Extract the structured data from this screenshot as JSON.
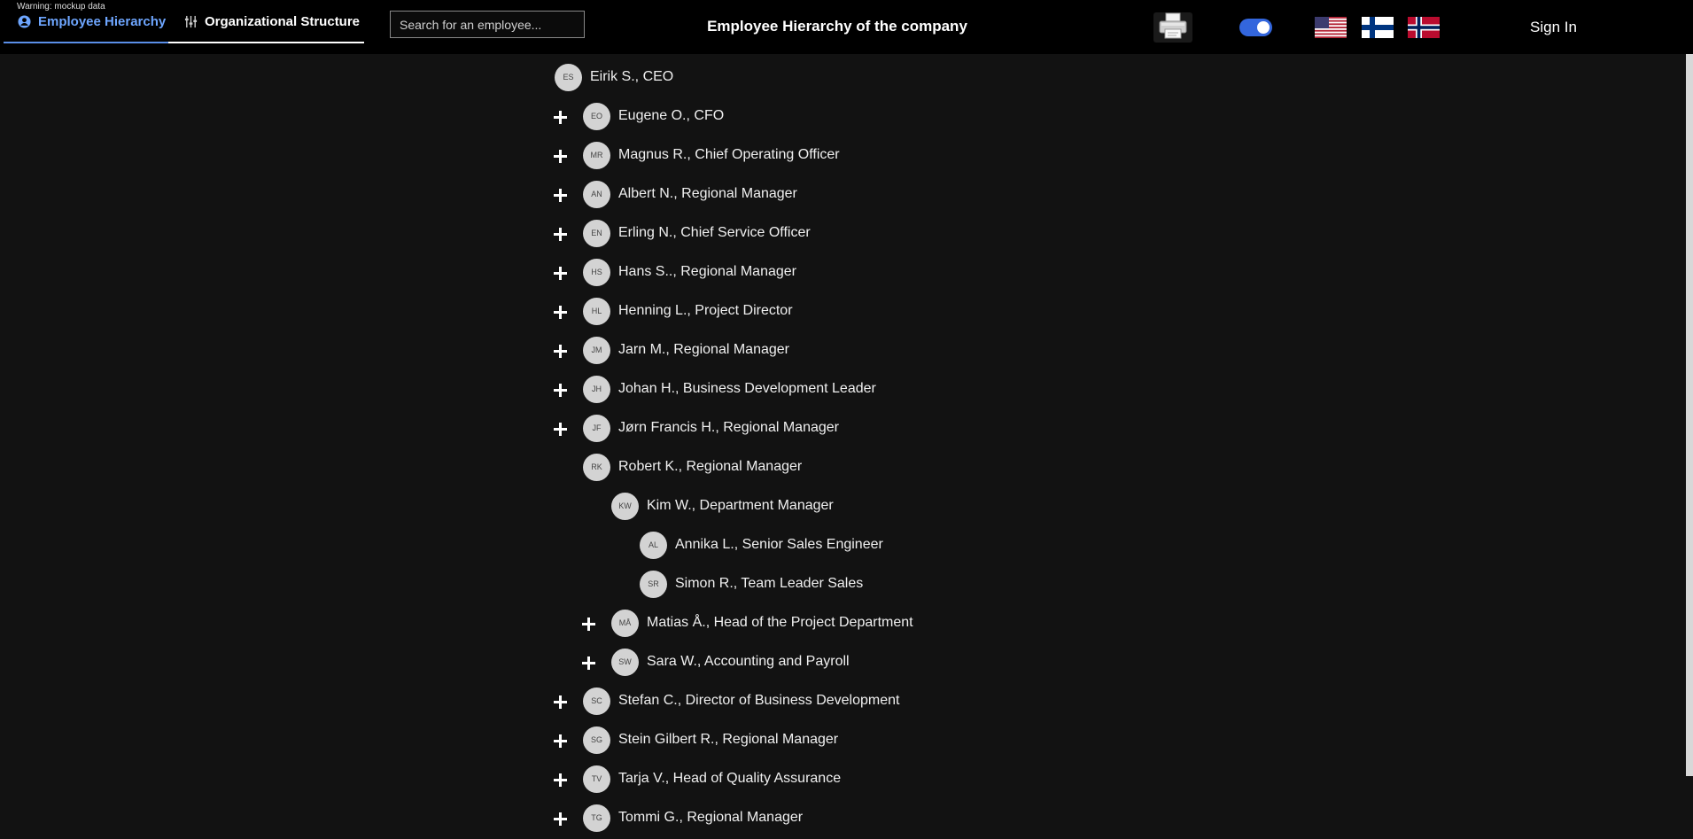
{
  "warning": "Warning: mockup data",
  "tabs": [
    {
      "label": "Employee Hierarchy",
      "icon": "account-circle-icon",
      "active": true
    },
    {
      "label": "Organizational Structure",
      "icon": "tune-sliders-icon",
      "active": false
    }
  ],
  "search": {
    "placeholder": "Search for an employee...",
    "value": ""
  },
  "title": "Employee Hierarchy of the company",
  "controls": {
    "printer_icon": "printer-icon",
    "toggle_icon": "toggle-switch-icon",
    "toggle_on": true,
    "toggle_color": "#3366dd"
  },
  "languages": [
    "english-flag-icon",
    "finnish-flag-icon",
    "norwegian-flag-icon"
  ],
  "signin_label": "Sign In",
  "accent": "#6ea6ff",
  "employees": [
    {
      "initials": "ES",
      "label": "Eirik S., CEO",
      "level": 0,
      "expandable": false
    },
    {
      "initials": "EO",
      "label": "Eugene O., CFO",
      "level": 1,
      "expandable": true
    },
    {
      "initials": "MR",
      "label": "Magnus R., Chief Operating Officer",
      "level": 1,
      "expandable": true
    },
    {
      "initials": "AN",
      "label": "Albert N., Regional Manager",
      "level": 1,
      "expandable": true
    },
    {
      "initials": "EN",
      "label": "Erling N., Chief Service Officer",
      "level": 1,
      "expandable": true
    },
    {
      "initials": "HS",
      "label": "Hans S.., Regional Manager",
      "level": 1,
      "expandable": true
    },
    {
      "initials": "HL",
      "label": "Henning L., Project Director",
      "level": 1,
      "expandable": true
    },
    {
      "initials": "JM",
      "label": "Jarn M., Regional Manager",
      "level": 1,
      "expandable": true
    },
    {
      "initials": "JH",
      "label": "Johan H., Business Development Leader",
      "level": 1,
      "expandable": true
    },
    {
      "initials": "JF",
      "label": "Jørn Francis H., Regional Manager",
      "level": 1,
      "expandable": true
    },
    {
      "initials": "RK",
      "label": "Robert K., Regional Manager",
      "level": 1,
      "expandable": false
    },
    {
      "initials": "KW",
      "label": "Kim W., Department Manager",
      "level": 2,
      "expandable": false
    },
    {
      "initials": "AL",
      "label": "Annika L., Senior Sales Engineer",
      "level": 3,
      "expandable": false
    },
    {
      "initials": "SR",
      "label": "Simon R., Team Leader Sales",
      "level": 3,
      "expandable": false
    },
    {
      "initials": "MÅ",
      "label": "Matias Å., Head of the Project Department",
      "level": 2,
      "expandable": true
    },
    {
      "initials": "SW",
      "label": "Sara W., Accounting and Payroll",
      "level": 2,
      "expandable": true
    },
    {
      "initials": "SC",
      "label": "Stefan C., Director of Business Development",
      "level": 1,
      "expandable": true
    },
    {
      "initials": "SG",
      "label": "Stein Gilbert R., Regional Manager",
      "level": 1,
      "expandable": true
    },
    {
      "initials": "TV",
      "label": "Tarja V., Head of Quality Assurance",
      "level": 1,
      "expandable": true
    },
    {
      "initials": "TG",
      "label": "Tommi G., Regional Manager",
      "level": 1,
      "expandable": true
    }
  ]
}
